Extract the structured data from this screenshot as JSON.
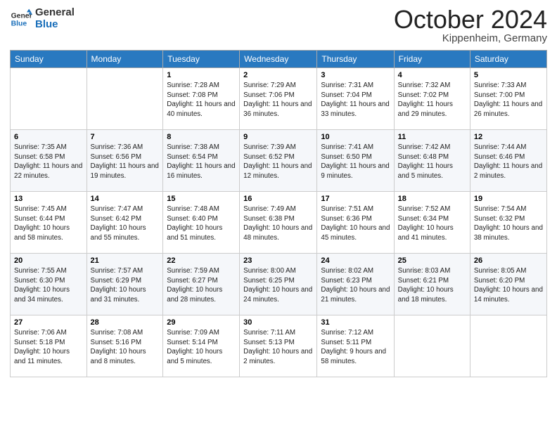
{
  "header": {
    "logo_line1": "General",
    "logo_line2": "Blue",
    "month_title": "October 2024",
    "location": "Kippenheim, Germany"
  },
  "weekdays": [
    "Sunday",
    "Monday",
    "Tuesday",
    "Wednesday",
    "Thursday",
    "Friday",
    "Saturday"
  ],
  "weeks": [
    [
      {
        "day": "",
        "info": ""
      },
      {
        "day": "",
        "info": ""
      },
      {
        "day": "1",
        "info": "Sunrise: 7:28 AM\nSunset: 7:08 PM\nDaylight: 11 hours and 40 minutes."
      },
      {
        "day": "2",
        "info": "Sunrise: 7:29 AM\nSunset: 7:06 PM\nDaylight: 11 hours and 36 minutes."
      },
      {
        "day": "3",
        "info": "Sunrise: 7:31 AM\nSunset: 7:04 PM\nDaylight: 11 hours and 33 minutes."
      },
      {
        "day": "4",
        "info": "Sunrise: 7:32 AM\nSunset: 7:02 PM\nDaylight: 11 hours and 29 minutes."
      },
      {
        "day": "5",
        "info": "Sunrise: 7:33 AM\nSunset: 7:00 PM\nDaylight: 11 hours and 26 minutes."
      }
    ],
    [
      {
        "day": "6",
        "info": "Sunrise: 7:35 AM\nSunset: 6:58 PM\nDaylight: 11 hours and 22 minutes."
      },
      {
        "day": "7",
        "info": "Sunrise: 7:36 AM\nSunset: 6:56 PM\nDaylight: 11 hours and 19 minutes."
      },
      {
        "day": "8",
        "info": "Sunrise: 7:38 AM\nSunset: 6:54 PM\nDaylight: 11 hours and 16 minutes."
      },
      {
        "day": "9",
        "info": "Sunrise: 7:39 AM\nSunset: 6:52 PM\nDaylight: 11 hours and 12 minutes."
      },
      {
        "day": "10",
        "info": "Sunrise: 7:41 AM\nSunset: 6:50 PM\nDaylight: 11 hours and 9 minutes."
      },
      {
        "day": "11",
        "info": "Sunrise: 7:42 AM\nSunset: 6:48 PM\nDaylight: 11 hours and 5 minutes."
      },
      {
        "day": "12",
        "info": "Sunrise: 7:44 AM\nSunset: 6:46 PM\nDaylight: 11 hours and 2 minutes."
      }
    ],
    [
      {
        "day": "13",
        "info": "Sunrise: 7:45 AM\nSunset: 6:44 PM\nDaylight: 10 hours and 58 minutes."
      },
      {
        "day": "14",
        "info": "Sunrise: 7:47 AM\nSunset: 6:42 PM\nDaylight: 10 hours and 55 minutes."
      },
      {
        "day": "15",
        "info": "Sunrise: 7:48 AM\nSunset: 6:40 PM\nDaylight: 10 hours and 51 minutes."
      },
      {
        "day": "16",
        "info": "Sunrise: 7:49 AM\nSunset: 6:38 PM\nDaylight: 10 hours and 48 minutes."
      },
      {
        "day": "17",
        "info": "Sunrise: 7:51 AM\nSunset: 6:36 PM\nDaylight: 10 hours and 45 minutes."
      },
      {
        "day": "18",
        "info": "Sunrise: 7:52 AM\nSunset: 6:34 PM\nDaylight: 10 hours and 41 minutes."
      },
      {
        "day": "19",
        "info": "Sunrise: 7:54 AM\nSunset: 6:32 PM\nDaylight: 10 hours and 38 minutes."
      }
    ],
    [
      {
        "day": "20",
        "info": "Sunrise: 7:55 AM\nSunset: 6:30 PM\nDaylight: 10 hours and 34 minutes."
      },
      {
        "day": "21",
        "info": "Sunrise: 7:57 AM\nSunset: 6:29 PM\nDaylight: 10 hours and 31 minutes."
      },
      {
        "day": "22",
        "info": "Sunrise: 7:59 AM\nSunset: 6:27 PM\nDaylight: 10 hours and 28 minutes."
      },
      {
        "day": "23",
        "info": "Sunrise: 8:00 AM\nSunset: 6:25 PM\nDaylight: 10 hours and 24 minutes."
      },
      {
        "day": "24",
        "info": "Sunrise: 8:02 AM\nSunset: 6:23 PM\nDaylight: 10 hours and 21 minutes."
      },
      {
        "day": "25",
        "info": "Sunrise: 8:03 AM\nSunset: 6:21 PM\nDaylight: 10 hours and 18 minutes."
      },
      {
        "day": "26",
        "info": "Sunrise: 8:05 AM\nSunset: 6:20 PM\nDaylight: 10 hours and 14 minutes."
      }
    ],
    [
      {
        "day": "27",
        "info": "Sunrise: 7:06 AM\nSunset: 5:18 PM\nDaylight: 10 hours and 11 minutes."
      },
      {
        "day": "28",
        "info": "Sunrise: 7:08 AM\nSunset: 5:16 PM\nDaylight: 10 hours and 8 minutes."
      },
      {
        "day": "29",
        "info": "Sunrise: 7:09 AM\nSunset: 5:14 PM\nDaylight: 10 hours and 5 minutes."
      },
      {
        "day": "30",
        "info": "Sunrise: 7:11 AM\nSunset: 5:13 PM\nDaylight: 10 hours and 2 minutes."
      },
      {
        "day": "31",
        "info": "Sunrise: 7:12 AM\nSunset: 5:11 PM\nDaylight: 9 hours and 58 minutes."
      },
      {
        "day": "",
        "info": ""
      },
      {
        "day": "",
        "info": ""
      }
    ]
  ]
}
